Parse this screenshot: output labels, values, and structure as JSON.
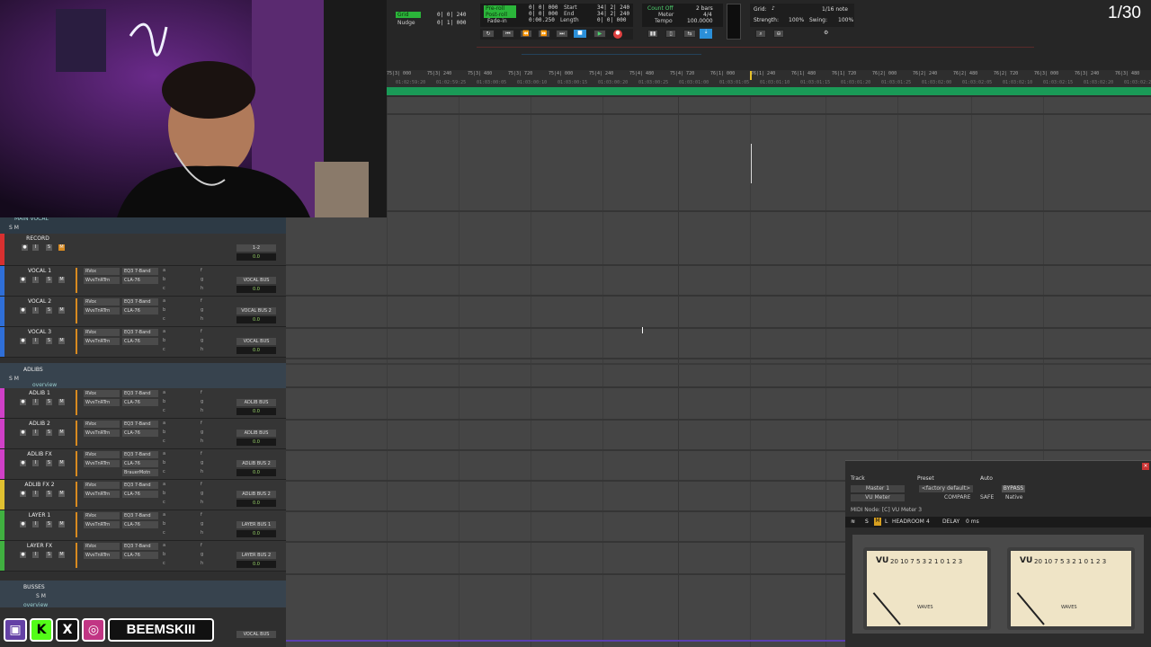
{
  "counter": "1/30",
  "toolbar": {
    "grid_label": "Grid",
    "grid_value": "0| 0| 240",
    "nudge_label": "Nudge",
    "nudge_value": "0| 1| 000",
    "preroll_label": "Pre-roll",
    "postroll_label": "Post-roll",
    "fadein_label": "Fade-in",
    "preroll_value": "0| 0| 000",
    "postroll_value": "0| 0| 000",
    "fadein_value": "0:00.250",
    "start_label": "Start",
    "end_label": "End",
    "length_label": "Length",
    "start_value": "34| 2| 240",
    "end_value": "34| 2| 240",
    "length_value": "0| 0| 000",
    "countoff_label": "Count Off",
    "meter_label": "Meter",
    "tempo_label": "Tempo",
    "countoff_value": "2 bars",
    "meter_value": "4/4",
    "tempo_value": "100.0000",
    "grid2_label": "Grid:",
    "grid2_value": "1/16 note",
    "strength_label": "Strength:",
    "strength_value": "100%",
    "swing_label": "Swing:",
    "swing_value": "100%"
  },
  "ruler": {
    "bars": [
      "75|3| 000",
      "75|3| 240",
      "75|3| 480",
      "75|3| 720",
      "75|4| 000",
      "75|4| 240",
      "75|4| 480",
      "75|4| 720",
      "76|1| 000",
      "76|1| 240",
      "76|1| 480",
      "76|1| 720",
      "76|2| 000",
      "76|2| 240",
      "76|2| 480",
      "76|2| 720",
      "76|3| 000",
      "76|3| 240",
      "76|3| 480",
      "76|3| 720"
    ],
    "times": [
      "01:02:59:20",
      "01:02:59:25",
      "01:03:00:05",
      "01:03:00:10",
      "01:03:00:15",
      "01:03:00:20",
      "01:03:00:25",
      "01:03:01:00",
      "01:03:01:05",
      "01:03:01:10",
      "01:03:01:15",
      "01:03:01:20",
      "01:03:01:25",
      "01:03:02:00",
      "01:03:02:05",
      "01:03:02:10",
      "01:03:02:15",
      "01:03:02:20",
      "01:03:02:25",
      "01:03:03:00"
    ]
  },
  "folders": {
    "main_vocal": "MAIN VOCAL",
    "adlibs": "ADLIBS",
    "busses": "BUSSES",
    "overview": "overview",
    "sm": "S M"
  },
  "record_track": {
    "name": "RECORD",
    "out": "1-2",
    "vol": "0.0",
    "pan": "0  0"
  },
  "tracks": [
    {
      "name": "VOCAL 1",
      "color": "#2f6fd8",
      "ins": [
        "RVox",
        "WvsTnRTrn",
        "EQ3 7-Band",
        "CLA-76"
      ],
      "out": "VOCAL BUS",
      "vol": "0.0"
    },
    {
      "name": "VOCAL 2",
      "color": "#2f6fd8",
      "ins": [
        "RVox",
        "WvsTnRTrn",
        "EQ3 7-Band",
        "CLA-76"
      ],
      "out": "VOCAL BUS 2",
      "vol": "0.0"
    },
    {
      "name": "VOCAL 3",
      "color": "#2f6fd8",
      "ins": [
        "RVox",
        "WvsTnRTrn",
        "EQ3 7-Band",
        "CLA-76"
      ],
      "out": "VOCAL BUS",
      "vol": "0.0"
    },
    {
      "name": "ADLIB 1",
      "color": "#d040c8",
      "ins": [
        "RVox",
        "WvsTnRTrn",
        "EQ3 7-Band",
        "CLA-76"
      ],
      "out": "ADLIB BUS",
      "vol": "0.0"
    },
    {
      "name": "ADLIB 2",
      "color": "#d040c8",
      "ins": [
        "RVox",
        "WvsTnRTrn",
        "EQ3 7-Band",
        "CLA-76"
      ],
      "out": "ADLIB BUS",
      "vol": "0.0"
    },
    {
      "name": "ADLIB FX",
      "color": "#d040c8",
      "ins": [
        "RVox",
        "WvsTnRTrn",
        "EQ3 7-Band",
        "CLA-76"
      ],
      "ins5": "BrauerMotn",
      "out": "ADLIB BUS 2",
      "vol": "0.0"
    },
    {
      "name": "ADLIB FX 2",
      "color": "#e0c030",
      "ins": [
        "RVox",
        "WvsTnRTrn",
        "EQ3 7-Band",
        "CLA-76"
      ],
      "out": "ADLIB BUS 2",
      "vol": "0.0"
    },
    {
      "name": "LAYER 1",
      "color": "#40b040",
      "ins": [
        "RVox",
        "WvsTnRTrn",
        "EQ3 7-Band",
        "CLA-76"
      ],
      "out": "LAYER BUS 1",
      "vol": "0.0"
    },
    {
      "name": "LAYER FX",
      "color": "#40b040",
      "ins": [
        "RVox",
        "WvsTnRTrn",
        "EQ3 7-Band",
        "CLA-76"
      ],
      "out": "LAYER BUS 2",
      "vol": "0.0"
    }
  ],
  "bottom_out": "VOCAL BUS",
  "plugin": {
    "track_label": "Track",
    "preset_label": "Preset",
    "auto_label": "Auto",
    "track_name": "Master 1",
    "preset_name": "<factory default>",
    "bypass": "BYPASS",
    "plugin_name": "VU Meter",
    "compare": "COMPARE",
    "safe": "SAFE",
    "native": "Native",
    "midi_node": "MIDI Node: [C] VU Meter 3",
    "headroom_label": "HEADROOM",
    "headroom_value": "4",
    "delay_label": "DELAY",
    "delay_value": "0 ms",
    "vu": "VU",
    "scale": "20 10 7 5 3 2 1 0  1  2  3",
    "brand": "WAVES"
  },
  "social": {
    "handle": "BEEMSKIII"
  }
}
